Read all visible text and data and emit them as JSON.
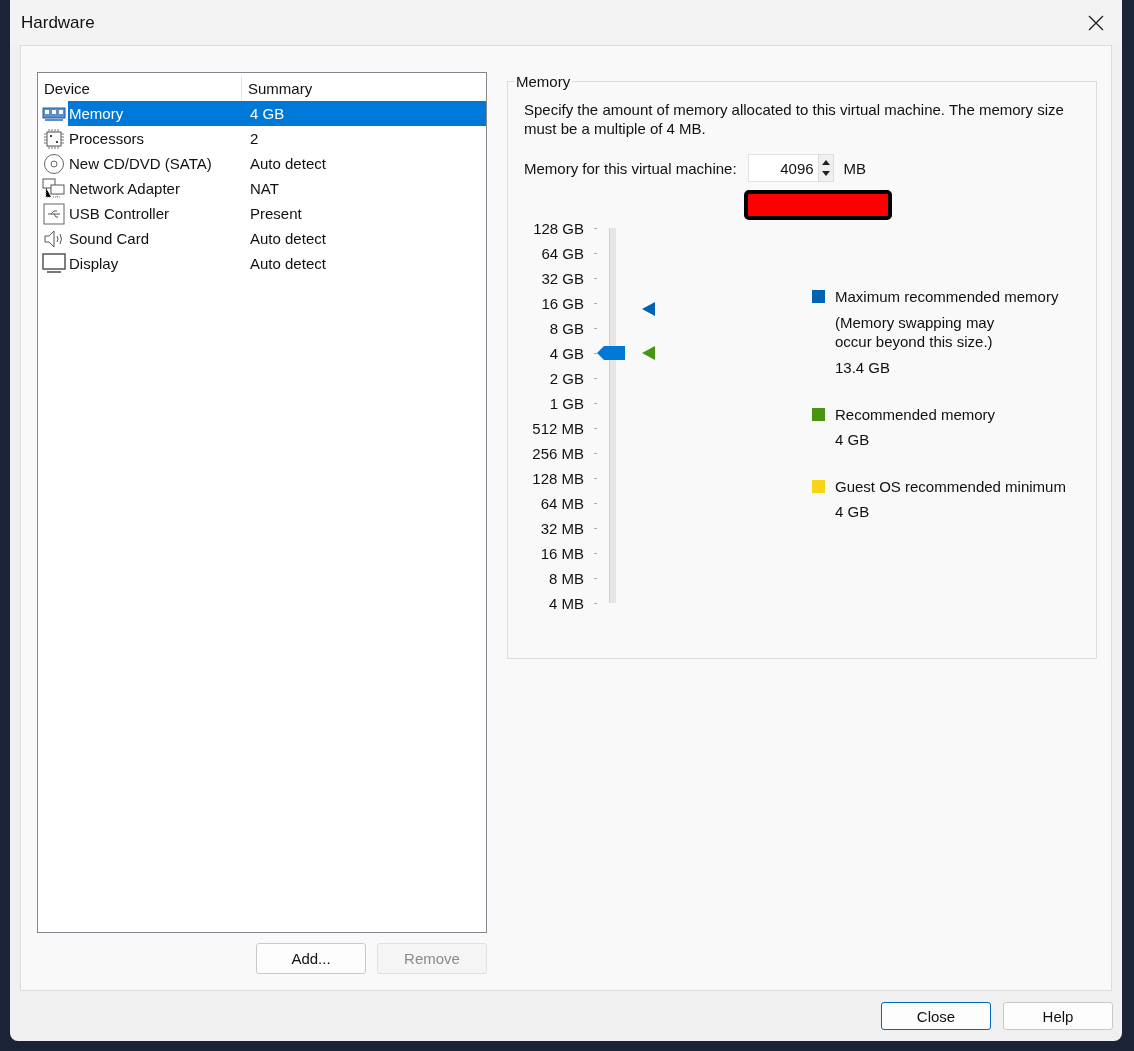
{
  "window": {
    "title": "Hardware"
  },
  "device_table": {
    "columns": [
      "Device",
      "Summary"
    ],
    "rows": [
      {
        "device": "Memory",
        "summary": "4 GB",
        "selected": true
      },
      {
        "device": "Processors",
        "summary": "2",
        "selected": false
      },
      {
        "device": "New CD/DVD (SATA)",
        "summary": "Auto detect",
        "selected": false
      },
      {
        "device": "Network Adapter",
        "summary": "NAT",
        "selected": false
      },
      {
        "device": "USB Controller",
        "summary": "Present",
        "selected": false
      },
      {
        "device": "Sound Card",
        "summary": "Auto detect",
        "selected": false
      },
      {
        "device": "Display",
        "summary": "Auto detect",
        "selected": false
      }
    ]
  },
  "table_buttons": [
    {
      "label": "Add...",
      "disabled": false
    },
    {
      "label": "Remove",
      "disabled": true
    }
  ],
  "memory_group": {
    "title": "Memory",
    "description": "Specify the amount of memory allocated to this virtual machine. The memory size must be a multiple of 4 MB.",
    "field_label": "Memory for this virtual machine:",
    "value": "4096",
    "unit": "MB",
    "slider": {
      "ticks": [
        "128 GB",
        "64 GB",
        "32 GB",
        "16 GB",
        "8 GB",
        "4 GB",
        "2 GB",
        "1 GB",
        "512 MB",
        "256 MB",
        "128 MB",
        "64 MB",
        "32 MB",
        "16 MB",
        "8 MB",
        "4 MB"
      ],
      "level": 0.667,
      "markers": [
        {
          "level": 0.783,
          "color": "#0063b1"
        },
        {
          "level": 0.667,
          "color": "#4a9413"
        }
      ]
    },
    "legend": [
      {
        "label": "Maximum recommended memory",
        "note": "(Memory swapping may\noccur beyond this size.)",
        "value": "13.4 GB",
        "color": "#0063b1"
      },
      {
        "label": "Recommended memory",
        "value": "4 GB",
        "color": "#4a9413"
      },
      {
        "label": "Guest OS recommended minimum",
        "value": "4 GB",
        "color": "#f7d516"
      }
    ]
  },
  "footer_buttons": [
    {
      "label": "Close",
      "default": true
    },
    {
      "label": "Help",
      "default": false
    }
  ]
}
